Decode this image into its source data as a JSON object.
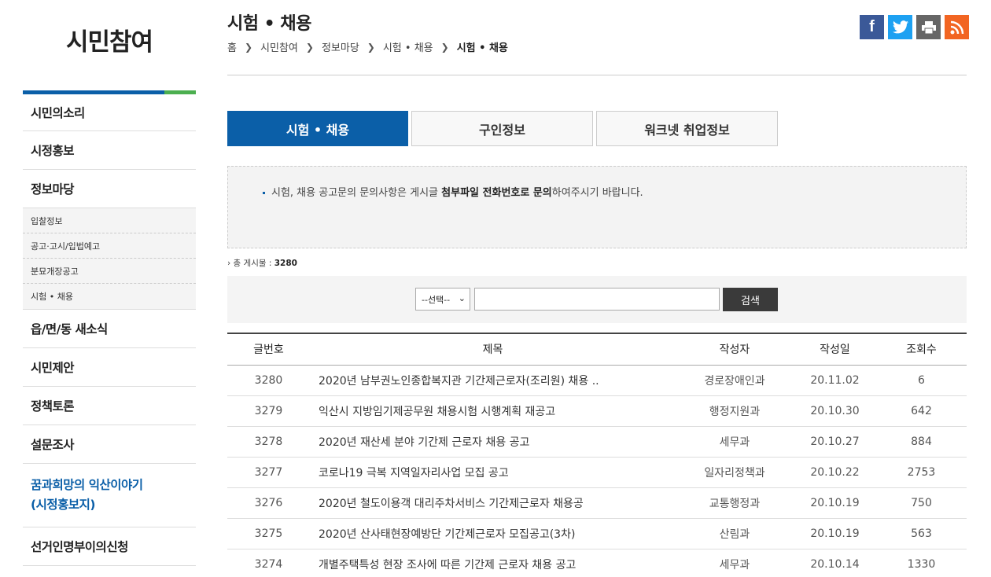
{
  "sidebar": {
    "title": "시민참여",
    "items": [
      {
        "label": "시민의소리"
      },
      {
        "label": "시정홍보"
      },
      {
        "label": "정보마당"
      }
    ],
    "sub_items": [
      "입찰정보",
      "공고·고시/입법예고",
      "분묘개장공고",
      "시험 • 채용"
    ],
    "items_after": [
      {
        "label": "읍/면/동 새소식"
      },
      {
        "label": "시민제안"
      },
      {
        "label": "정책토론"
      },
      {
        "label": "설문조사"
      }
    ],
    "story_line1": "꿈과희망의 익산이야기",
    "story_line2": "(시정홍보지)",
    "last_item": "선거인명부이의신청"
  },
  "header": {
    "title": "시험 • 채용",
    "breadcrumb": [
      "홈",
      "시민참여",
      "정보마당",
      "시험 • 채용",
      "시험 • 채용"
    ]
  },
  "share": {
    "facebook_icon": "facebook-icon",
    "twitter_icon": "twitter-icon",
    "print_icon": "print-icon",
    "rss_icon": "rss-icon"
  },
  "tabs": [
    {
      "label": "시험 • 채용",
      "active": true
    },
    {
      "label": "구인정보",
      "active": false
    },
    {
      "label": "워크넷 취업정보",
      "active": false
    }
  ],
  "notice": {
    "prefix": "시험, 채용 공고문의 문의사항은 게시글 ",
    "bold": "첨부파일 전화번호로 문의",
    "suffix": "하여주시기 바랍니다."
  },
  "total": {
    "label": "› 총 게시물 : ",
    "count": "3280"
  },
  "search": {
    "select_value": "--선택--",
    "input_value": "",
    "button_label": "검색"
  },
  "table": {
    "columns": [
      "글번호",
      "제목",
      "작성자",
      "작성일",
      "조회수"
    ],
    "rows": [
      {
        "no": "3280",
        "title": "2020년 남부권노인종합복지관 기간제근로자(조리원) 채용 ..",
        "author": "경로장애인과",
        "date": "20.11.02",
        "views": "6"
      },
      {
        "no": "3279",
        "title": "익산시 지방임기제공무원 채용시험 시행계획 재공고",
        "author": "행정지원과",
        "date": "20.10.30",
        "views": "642"
      },
      {
        "no": "3278",
        "title": "2020년 재산세 분야 기간제 근로자 채용 공고",
        "author": "세무과",
        "date": "20.10.27",
        "views": "884"
      },
      {
        "no": "3277",
        "title": "코로나19 극복 지역일자리사업 모집 공고",
        "author": "일자리정책과",
        "date": "20.10.22",
        "views": "2753"
      },
      {
        "no": "3276",
        "title": "2020년 철도이용객 대리주차서비스 기간제근로자 채용공",
        "author": "교통행정과",
        "date": "20.10.19",
        "views": "750"
      },
      {
        "no": "3275",
        "title": "2020년 산사태현장예방단 기간제근로자 모집공고(3차)",
        "author": "산림과",
        "date": "20.10.19",
        "views": "563"
      },
      {
        "no": "3274",
        "title": "개별주택특성 현장 조사에 따른 기간제 근로자 채용 공고",
        "author": "세무과",
        "date": "20.10.14",
        "views": "1330"
      }
    ]
  },
  "colors": {
    "primary_blue": "#0b5fa8",
    "accent_green": "#4caf50",
    "facebook": "#3b5998",
    "twitter": "#1da1f2",
    "rss": "#f26522"
  }
}
